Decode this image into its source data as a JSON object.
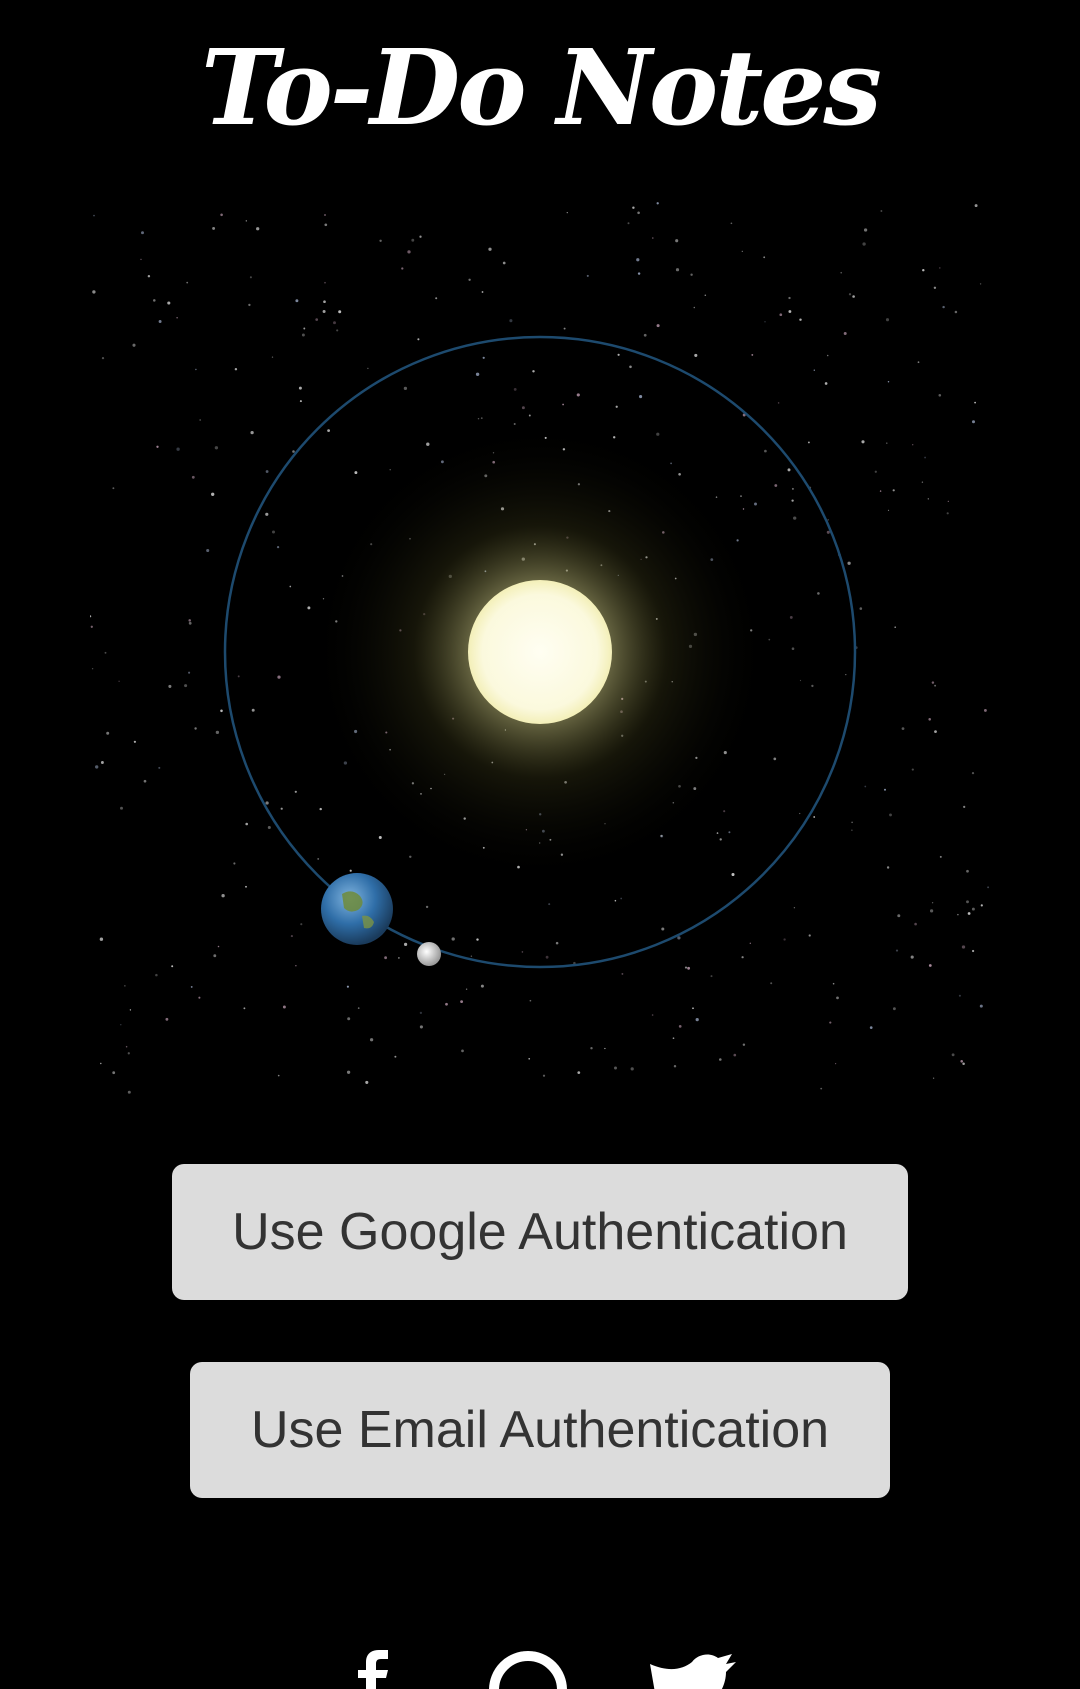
{
  "header": {
    "title": "To-Do Notes"
  },
  "scene": {
    "description_icons": [
      "sun-icon",
      "earth-icon",
      "moon-icon",
      "orbit-path"
    ],
    "colors": {
      "background": "#000000",
      "sun": "#fbf9dd",
      "sun_glow": "#e8e49a",
      "orbit": "#1d4a6e",
      "earth_ocean": "#2f6ea8",
      "earth_land": "#6f8b3a",
      "moon": "#d8d8d8"
    }
  },
  "auth": {
    "google_label": "Use Google Authentication",
    "email_label": "Use Email Authentication"
  },
  "social": {
    "icons": [
      "facebook-icon",
      "pinterest-icon",
      "twitter-icon"
    ]
  },
  "colors": {
    "button_background": "#dcdcdc",
    "button_text": "#333333",
    "title_text": "#ffffff"
  }
}
